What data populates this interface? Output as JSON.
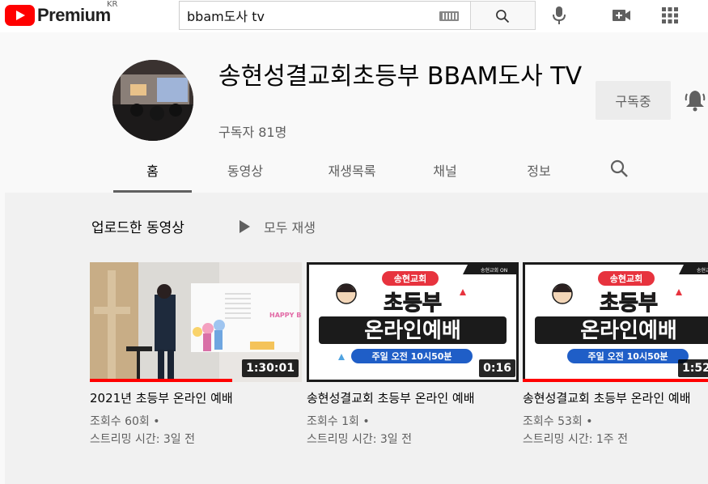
{
  "header": {
    "logo_text": "Premium",
    "logo_region": "KR",
    "search_value": "bbam도사 tv"
  },
  "channel": {
    "title": "송현성결교회초등부 BBAM도사 TV",
    "subscribers": "구독자 81명",
    "subscribe_label": "구독중"
  },
  "tabs": [
    {
      "label": "홈",
      "active": true
    },
    {
      "label": "동영상",
      "active": false
    },
    {
      "label": "재생목록",
      "active": false
    },
    {
      "label": "채널",
      "active": false
    },
    {
      "label": "정보",
      "active": false
    }
  ],
  "section": {
    "title": "업로드한 동영상",
    "play_all": "모두 재생"
  },
  "videos": [
    {
      "title": "2021년 초등부 온라인 예배",
      "views": "조회수 60회 •",
      "age": "스트리밍 시간: 3일 전",
      "duration": "1:30:01",
      "progress": 0.67,
      "thumb_text": "HAPPY BIRTHDAY"
    },
    {
      "title": "송현성결교회 초등부 온라인 예배",
      "views": "조회수 1회 •",
      "age": "스트리밍 시간: 3일 전",
      "duration": "0:16",
      "progress": 0.0,
      "thumb_badge": "송현교회 ON",
      "thumb_church": "송현교회",
      "thumb_line1": "초등부",
      "thumb_line2": "온라인예배",
      "thumb_time": "주일 오전 10시50분"
    },
    {
      "title": "송현성결교회 초등부 온라인 예배",
      "views": "조회수 53회 •",
      "age": "스트리밍 시간: 1주 전",
      "duration": "1:52",
      "progress": 1.0,
      "thumb_badge": "송현교회 ON",
      "thumb_church": "송현교회",
      "thumb_line1": "초등부",
      "thumb_line2": "온라인예배",
      "thumb_time": "주일 오전 10시50분"
    }
  ],
  "colors": {
    "brand_red": "#ff0000",
    "text_primary": "#030303",
    "text_secondary": "#606060"
  }
}
